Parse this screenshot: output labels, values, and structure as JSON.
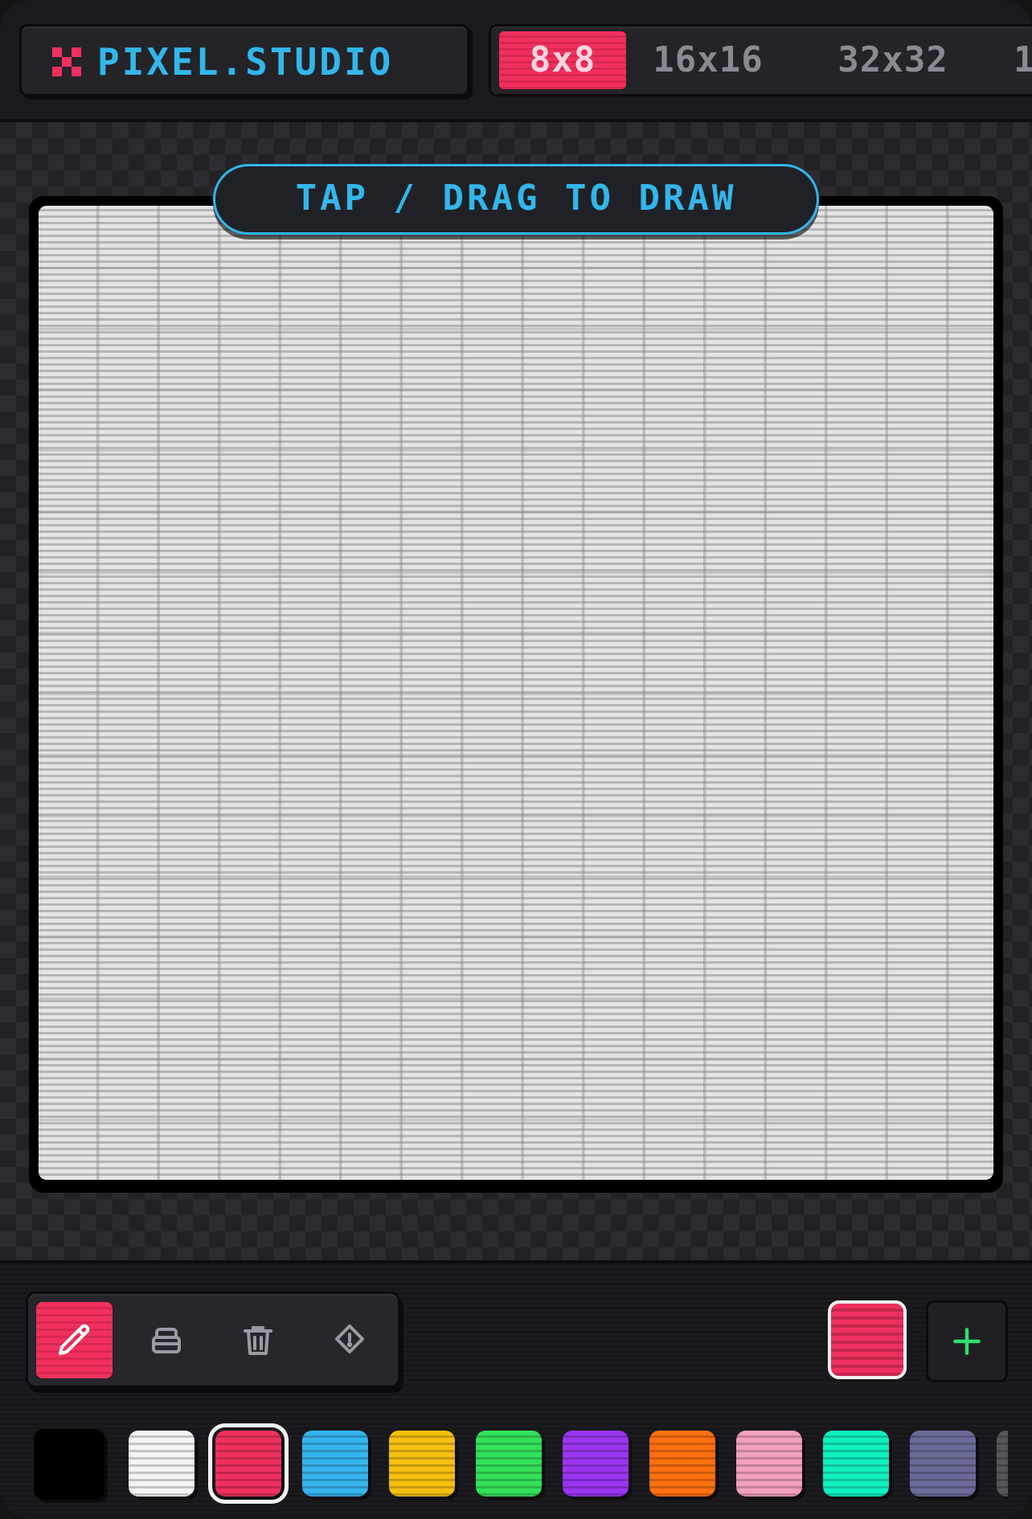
{
  "app": {
    "title": "PIXEL.STUDIO"
  },
  "size_tabs": [
    {
      "label": "8x8",
      "active": true
    },
    {
      "label": "16x16",
      "active": false
    },
    {
      "label": "32x32",
      "active": false
    },
    {
      "label": "1",
      "active": false
    }
  ],
  "canvas": {
    "hint": "TAP / DRAG TO DRAW",
    "grid_size": 16
  },
  "tools": [
    {
      "name": "pencil-icon",
      "active": true
    },
    {
      "name": "eraser-icon",
      "active": false
    },
    {
      "name": "trash-icon",
      "active": false
    },
    {
      "name": "fill-bucket-icon",
      "active": false
    }
  ],
  "current_color": "#f0305f",
  "accent_colors": {
    "brand": "#33b6ea",
    "active": "#f0305f",
    "add": "#2ee06b"
  },
  "palette": [
    {
      "color": "#000000",
      "selected": false
    },
    {
      "color": "#f4f4f4",
      "selected": false
    },
    {
      "color": "#f0305f",
      "selected": true
    },
    {
      "color": "#36b4ee",
      "selected": false
    },
    {
      "color": "#f5c010",
      "selected": false
    },
    {
      "color": "#33e05a",
      "selected": false
    },
    {
      "color": "#9a35f0",
      "selected": false
    },
    {
      "color": "#ff7010",
      "selected": false
    },
    {
      "color": "#f3a0c0",
      "selected": false
    },
    {
      "color": "#10f0c0",
      "selected": false
    },
    {
      "color": "#6a6a9a",
      "selected": false
    },
    {
      "color": "#55555e",
      "selected": false
    }
  ]
}
